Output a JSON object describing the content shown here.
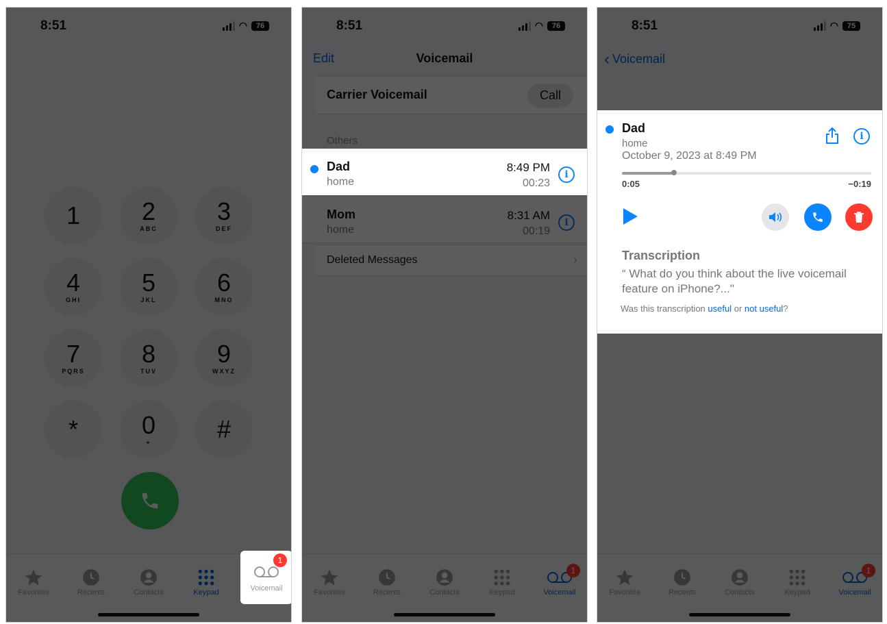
{
  "status": {
    "time": "8:51",
    "battery1": "76",
    "battery2": "76",
    "battery3": "75"
  },
  "keypad": {
    "keys": [
      {
        "num": "1",
        "sub": ""
      },
      {
        "num": "2",
        "sub": "ABC"
      },
      {
        "num": "3",
        "sub": "DEF"
      },
      {
        "num": "4",
        "sub": "GHI"
      },
      {
        "num": "5",
        "sub": "JKL"
      },
      {
        "num": "6",
        "sub": "MNO"
      },
      {
        "num": "7",
        "sub": "PQRS"
      },
      {
        "num": "8",
        "sub": "TUV"
      },
      {
        "num": "9",
        "sub": "WXYZ"
      },
      {
        "num": "*",
        "sub": ""
      },
      {
        "num": "0",
        "sub": "+"
      },
      {
        "num": "#",
        "sub": ""
      }
    ]
  },
  "tabs": {
    "favorites": "Favorites",
    "recents": "Recents",
    "contacts": "Contacts",
    "keypad": "Keypad",
    "voicemail": "Voicemail",
    "badge": "1"
  },
  "voicemail_list": {
    "edit": "Edit",
    "title": "Voicemail",
    "carrier_label": "Carrier Voicemail",
    "call_label": "Call",
    "section": "Others",
    "items": [
      {
        "name": "Dad",
        "label": "home",
        "time": "8:49 PM",
        "duration": "00:23"
      },
      {
        "name": "Mom",
        "label": "home",
        "time": "8:31 AM",
        "duration": "00:19"
      }
    ],
    "deleted": "Deleted Messages"
  },
  "detail": {
    "back": "Voicemail",
    "name": "Dad",
    "label": "home",
    "date": "October 9, 2023 at 8:49 PM",
    "elapsed": "0:05",
    "remaining": "−0:19",
    "progress": 0.21,
    "transcription_heading": "Transcription",
    "transcription_text": "“ What do you think about the live voicemail feature on iPhone?...\"",
    "feedback_prefix": "Was this transcription ",
    "feedback_useful": "useful",
    "feedback_or": " or ",
    "feedback_not_useful": "not useful",
    "feedback_suffix": "?"
  },
  "colors": {
    "accent": "#0a84ff",
    "call_green": "#34c759",
    "delete_red": "#ff3b30"
  }
}
